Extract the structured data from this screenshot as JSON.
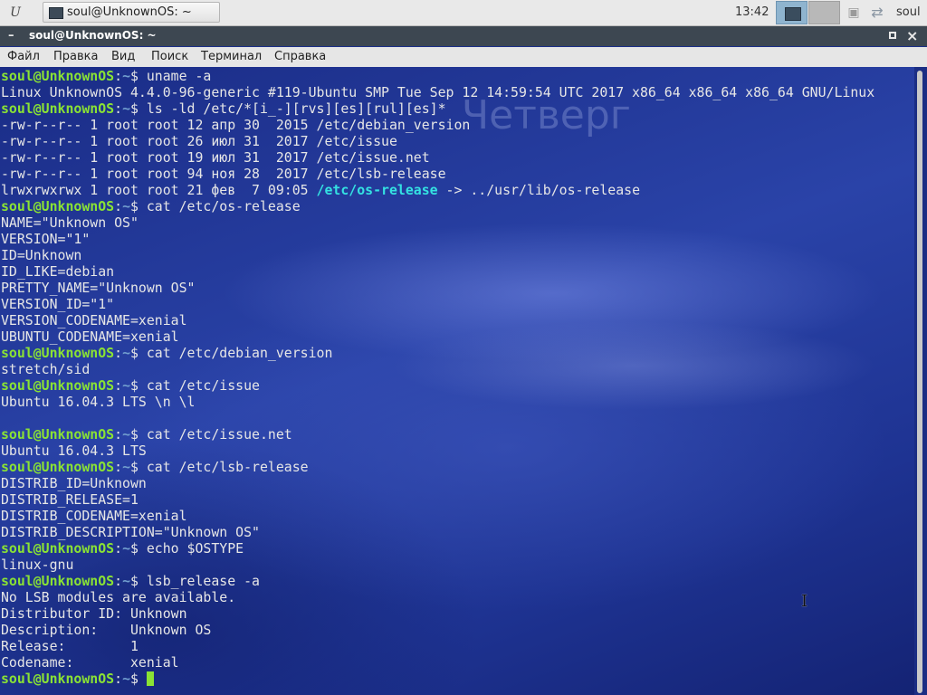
{
  "panel": {
    "menu_glyph": "U",
    "task_label": "soul@UnknownOS: ~",
    "clock": "13:42",
    "user": "soul"
  },
  "window": {
    "title": "soul@UnknownOS: ~"
  },
  "menu": {
    "file": "Файл",
    "edit": "Правка",
    "view": "Вид",
    "search": "Поиск",
    "terminal": "Терминал",
    "help": "Справка"
  },
  "wallpaper": {
    "text": "Четверг"
  },
  "prompt": {
    "user": "soul@UnknownOS",
    "sep": ":",
    "dir": "~",
    "sym": "$ "
  },
  "terminal": {
    "lines": [
      {
        "cmd": "uname -a"
      },
      {
        "text": "Linux UnknownOS 4.4.0-96-generic #119-Ubuntu SMP Tue Sep 12 14:59:54 UTC 2017 x86_64 x86_64 x86_64 GNU/Linux"
      },
      {
        "cmd": "ls -ld /etc/*[i_-][rvs][es][rul][es]*"
      },
      {
        "text": "-rw-r--r-- 1 root root 12 апр 30  2015 /etc/debian_version"
      },
      {
        "text": "-rw-r--r-- 1 root root 26 июл 31  2017 /etc/issue"
      },
      {
        "text": "-rw-r--r-- 1 root root 19 июл 31  2017 /etc/issue.net"
      },
      {
        "text": "-rw-r--r-- 1 root root 94 ноя 28  2017 /etc/lsb-release"
      },
      {
        "text": "lrwxrwxrwx 1 root root 21 фев  7 09:05 ",
        "link": "/etc/os-release",
        "after": " -> ../usr/lib/os-release"
      },
      {
        "cmd": "cat /etc/os-release"
      },
      {
        "text": "NAME=\"Unknown OS\""
      },
      {
        "text": "VERSION=\"1\""
      },
      {
        "text": "ID=Unknown"
      },
      {
        "text": "ID_LIKE=debian"
      },
      {
        "text": "PRETTY_NAME=\"Unknown OS\""
      },
      {
        "text": "VERSION_ID=\"1\""
      },
      {
        "text": "VERSION_CODENAME=xenial"
      },
      {
        "text": "UBUNTU_CODENAME=xenial"
      },
      {
        "cmd": "cat /etc/debian_version"
      },
      {
        "text": "stretch/sid"
      },
      {
        "cmd": "cat /etc/issue"
      },
      {
        "text": "Ubuntu 16.04.3 LTS \\n \\l"
      },
      {
        "text": ""
      },
      {
        "cmd": "cat /etc/issue.net"
      },
      {
        "text": "Ubuntu 16.04.3 LTS"
      },
      {
        "cmd": "cat /etc/lsb-release"
      },
      {
        "text": "DISTRIB_ID=Unknown"
      },
      {
        "text": "DISTRIB_RELEASE=1"
      },
      {
        "text": "DISTRIB_CODENAME=xenial"
      },
      {
        "text": "DISTRIB_DESCRIPTION=\"Unknown OS\""
      },
      {
        "cmd": "echo $OSTYPE"
      },
      {
        "text": "linux-gnu"
      },
      {
        "cmd": "lsb_release -a"
      },
      {
        "text": "No LSB modules are available."
      },
      {
        "text": "Distributor ID:\tUnknown"
      },
      {
        "text": "Description:\tUnknown OS"
      },
      {
        "text": "Release:\t1"
      },
      {
        "text": "Codename:\txenial"
      },
      {
        "cmd": "",
        "cursor": true
      }
    ]
  },
  "colors": {
    "prompt_user": "#8ae234",
    "prompt_dir": "#729fcf",
    "symlink": "#34e2e2",
    "terminal_text": "#e6e6e6",
    "titlebar": "#3d4751"
  }
}
